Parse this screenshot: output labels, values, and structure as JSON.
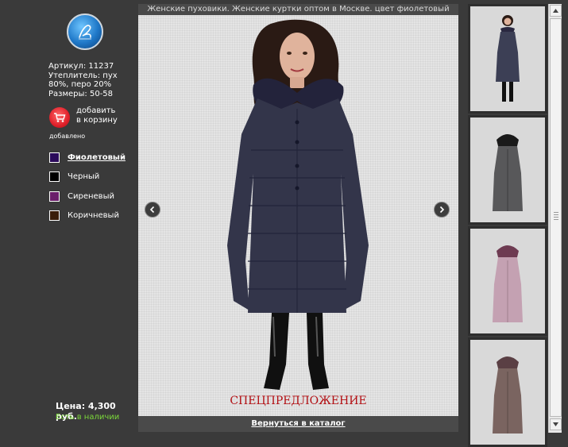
{
  "product": {
    "article": "Артикул: 11237",
    "filler_line1": "Утеплитель: пух",
    "filler_line2": "80%, перо 20%",
    "sizes": "Размеры: 50-58"
  },
  "cart": {
    "add_line1": "добавить",
    "add_line2": "в корзину",
    "added_text": "добавлено",
    "icon": "shopping-cart-icon"
  },
  "colors": [
    {
      "label": "Фиолетовый",
      "hex": "#2a0a5a",
      "selected": true
    },
    {
      "label": "Черный",
      "hex": "#000000",
      "selected": false
    },
    {
      "label": "Сиреневый",
      "hex": "#6a1e6a",
      "selected": false
    },
    {
      "label": "Коричневый",
      "hex": "#3a1e0a",
      "selected": false
    }
  ],
  "price": "Цена: 4,300 руб.",
  "stock": "Есть в наличии",
  "viewer": {
    "title": "Женские пуховики. Женские куртки оптом в Москве. цвет фиолетовый",
    "special_offer": "СПЕЦПРЕДЛОЖЕНИЕ",
    "back_link": "Вернуться в каталог",
    "prev_icon": "chevron-left-icon",
    "next_icon": "chevron-right-icon"
  },
  "thumbnails": [
    {
      "coat_color": "#3c3f55",
      "fur_color": "#2a2840"
    },
    {
      "coat_color": "#58585a",
      "fur_color": "#1a1a1a"
    },
    {
      "coat_color": "#c4a1b2",
      "fur_color": "#6e3b52"
    },
    {
      "coat_color": "#7a6460",
      "fur_color": "#5a3f44"
    }
  ],
  "theme": {
    "background": "#3a3a3a",
    "accent_red": "#b20e12",
    "stock_green": "#7cd93a"
  }
}
